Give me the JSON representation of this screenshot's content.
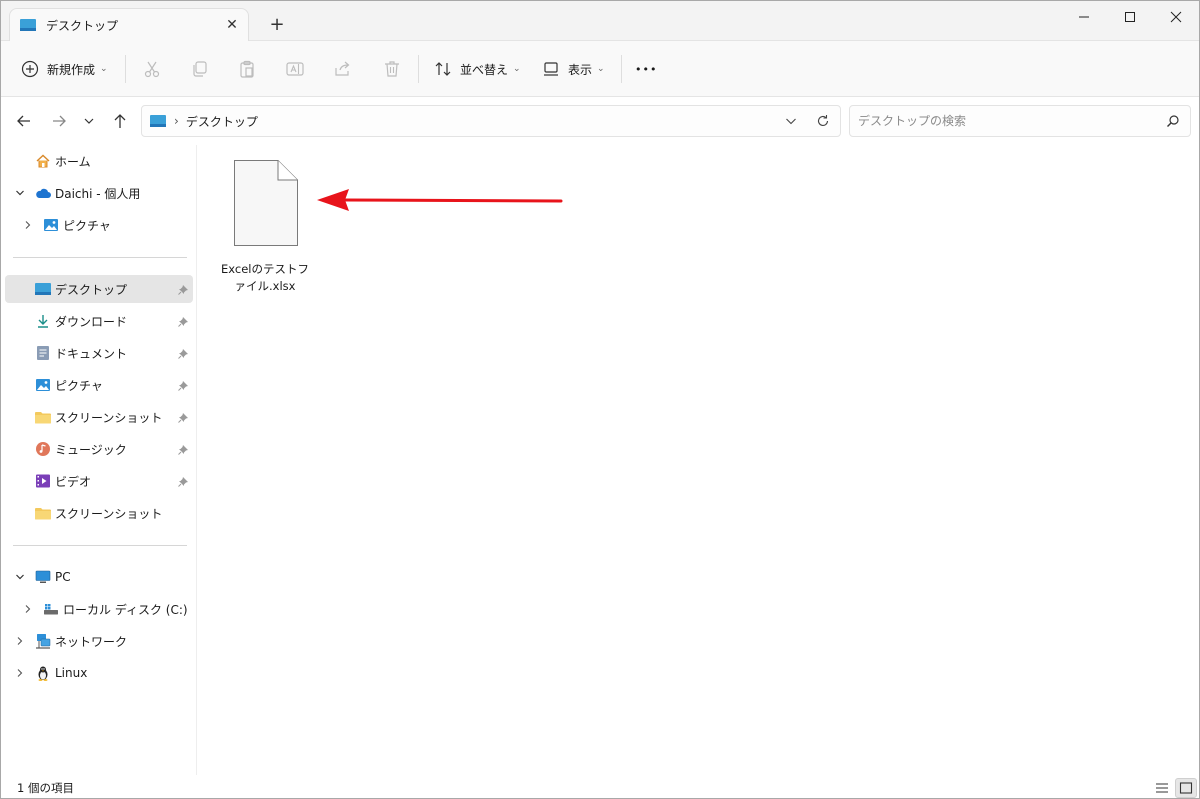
{
  "window": {
    "tab_title": "デスクトップ",
    "tab_close": "✕",
    "new_tab": "+"
  },
  "toolbar": {
    "new_label": "新規作成",
    "sort_label": "並べ替え",
    "view_label": "表示",
    "more_label": "•••"
  },
  "address": {
    "crumb_separator": "›",
    "crumbs": [
      "デスクトップ"
    ]
  },
  "search": {
    "placeholder": "デスクトップの検索"
  },
  "sidebar": {
    "items": [
      {
        "label": "ホーム",
        "icon": "home-icon"
      },
      {
        "label": "Daichi - 個人用",
        "icon": "onedrive-cloud-icon"
      },
      {
        "label": "ピクチャ",
        "icon": "pictures-icon"
      },
      {
        "label": "デスクトップ",
        "icon": "desktop-folder-icon",
        "pinned": true,
        "selected": true
      },
      {
        "label": "ダウンロード",
        "icon": "download-icon",
        "pinned": true
      },
      {
        "label": "ドキュメント",
        "icon": "document-icon",
        "pinned": true
      },
      {
        "label": "ピクチャ",
        "icon": "pictures-icon",
        "pinned": true
      },
      {
        "label": "スクリーンショット",
        "icon": "folder-icon",
        "pinned": true
      },
      {
        "label": "ミュージック",
        "icon": "music-icon",
        "pinned": true
      },
      {
        "label": "ビデオ",
        "icon": "video-icon",
        "pinned": true
      },
      {
        "label": "スクリーンショット",
        "icon": "folder-icon"
      },
      {
        "label": "PC",
        "icon": "pc-icon"
      },
      {
        "label": "ローカル ディスク (C:)",
        "icon": "drive-icon"
      },
      {
        "label": "ネットワーク",
        "icon": "network-icon"
      },
      {
        "label": "Linux",
        "icon": "linux-penguin-icon"
      }
    ]
  },
  "files": [
    {
      "name": "Excelのテストファイル.xlsx",
      "icon": "blank-file-icon"
    }
  ],
  "status": {
    "item_count": "1 個の項目"
  },
  "colors": {
    "arrow": "#e8141b",
    "accent": "#0067c0",
    "folder": "#f3c95d",
    "desktop_folder": "#3aa0d8"
  }
}
